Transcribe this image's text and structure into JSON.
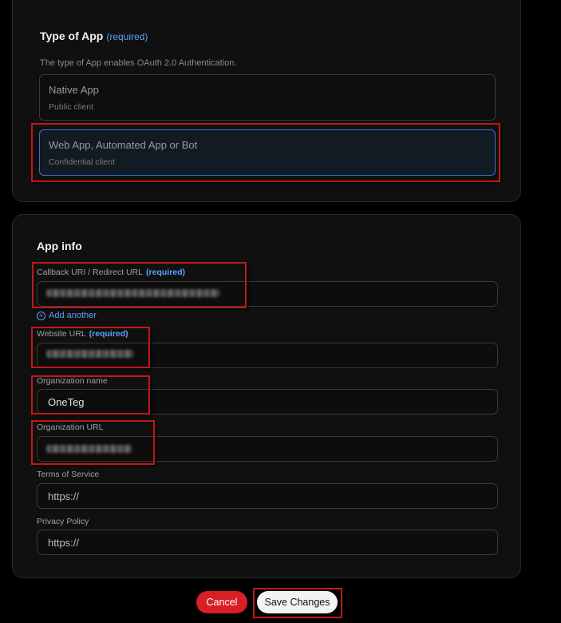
{
  "type_section": {
    "title": "Type of App",
    "required": "(required)",
    "description": "The type of App enables OAuth 2.0 Authentication.",
    "options": [
      {
        "title": "Native App",
        "subtitle": "Public client"
      },
      {
        "title": "Web App, Automated App or Bot",
        "subtitle": "Confidential client",
        "selected": true
      }
    ]
  },
  "app_info": {
    "title": "App info",
    "callback": {
      "label": "Callback URI / Redirect URL",
      "required": "(required)"
    },
    "add_another": "Add another",
    "website": {
      "label": "Website URL",
      "required": "(required)"
    },
    "org_name": {
      "label": "Organization name",
      "value": "OneTeg"
    },
    "org_url": {
      "label": "Organization URL"
    },
    "terms": {
      "label": "Terms of Service",
      "placeholder": "https://"
    },
    "privacy": {
      "label": "Privacy Policy",
      "placeholder": "https://"
    }
  },
  "actions": {
    "cancel": "Cancel",
    "save": "Save Changes"
  },
  "colors": {
    "accent": "#5aa0ff",
    "danger": "#d81f26",
    "highlight": "#c01818"
  }
}
